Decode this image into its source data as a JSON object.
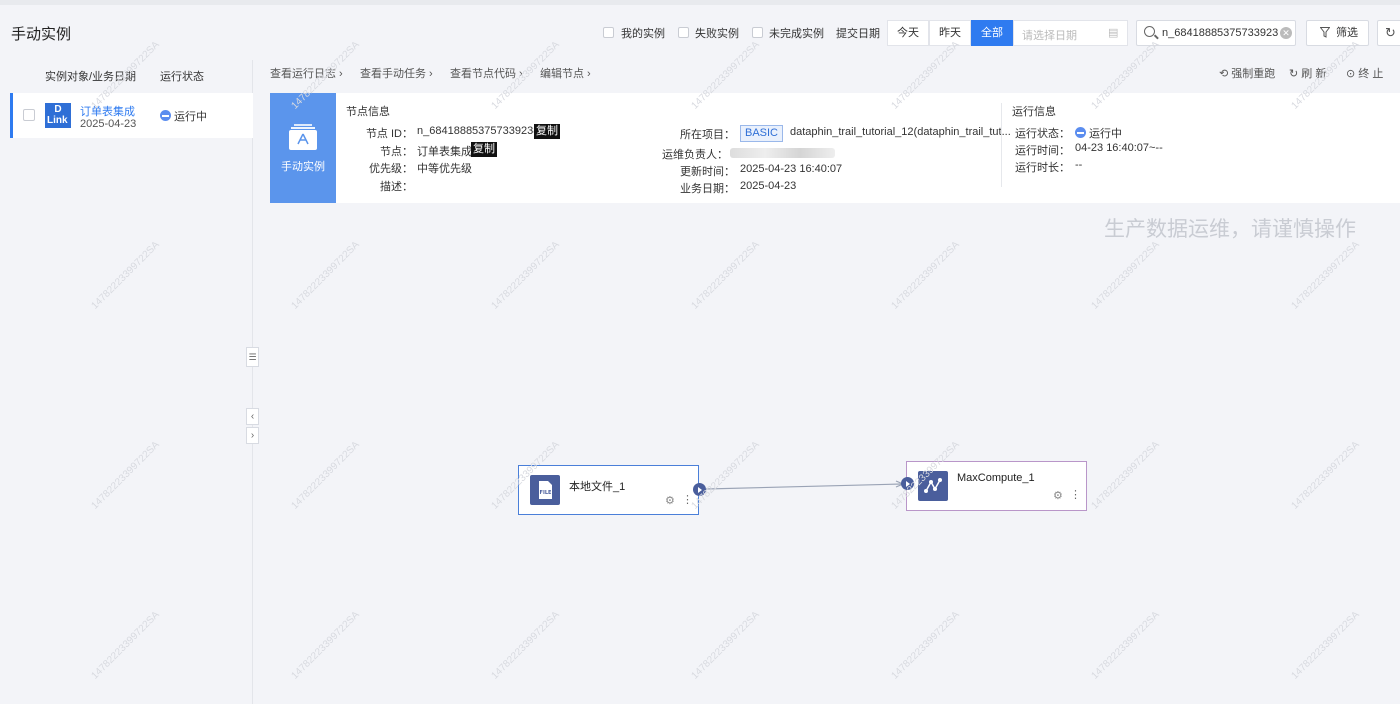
{
  "header": {
    "title": "手动实例",
    "filters": [
      {
        "label": "我的实例",
        "checked": false
      },
      {
        "label": "失败实例",
        "checked": false
      },
      {
        "label": "未完成实例",
        "checked": false
      }
    ],
    "submit_date_label": "提交日期",
    "date_buttons": [
      {
        "label": "今天",
        "active": false
      },
      {
        "label": "昨天",
        "active": false
      },
      {
        "label": "全部",
        "active": true
      }
    ],
    "date_placeholder": "请选择日期",
    "search_value": "n_6841888537573392384",
    "filter_label": "筛选"
  },
  "list": {
    "col_object": "实例对象/业务日期",
    "col_status": "运行状态",
    "rows": [
      {
        "logo_line1": "D",
        "logo_line2": "Link",
        "name": "订单表集成",
        "date": "2025-04-23",
        "status": "运行中",
        "selected": true
      }
    ]
  },
  "breadcrumbs": [
    "查看运行日志 ›",
    "查看手动任务 ›",
    "查看节点代码 ›",
    "编辑节点 ›"
  ],
  "actions": {
    "force_rerun": "强制重跑",
    "refresh": "刷 新",
    "stop": "终 止"
  },
  "card": {
    "icon_label": "手动实例",
    "node_info_title": "节点信息",
    "node_id_key": "节点 ID：",
    "node_id": "n_6841888537573392384",
    "copy_label": "复制",
    "node_key": "节点：",
    "node_name": "订单表集成",
    "priority_key": "优先级：",
    "priority": "中等优先级",
    "desc_key": "描述：",
    "project_key": "所在项目：",
    "project_tag": "BASIC",
    "project_name": "dataphin_trail_tutorial_12(dataphin_trail_tut...",
    "owner_key": "运维负责人：",
    "updated_key": "更新时间：",
    "updated": "2025-04-23 16:40:07",
    "biz_date_key": "业务日期：",
    "biz_date": "2025-04-23",
    "run_info_title": "运行信息",
    "run_status_key": "运行状态：",
    "run_status": "运行中",
    "run_time_key": "运行时间：",
    "run_time": "04-23 16:40:07~--",
    "run_duration_key": "运行时长：",
    "run_duration": "--"
  },
  "warning_text": "生产数据运维，请谨慎操作",
  "dag": {
    "nodes": [
      {
        "label": "本地文件_1",
        "icon": "file-icon",
        "icon_text": "FILE"
      },
      {
        "label": "MaxCompute_1",
        "icon": "maxcompute-icon"
      }
    ]
  },
  "watermark": "14782223399722SA",
  "colors": {
    "accent": "#2f7bf0",
    "node_icon": "#4a5e9c",
    "card_icon_bg": "#5b95ec"
  }
}
